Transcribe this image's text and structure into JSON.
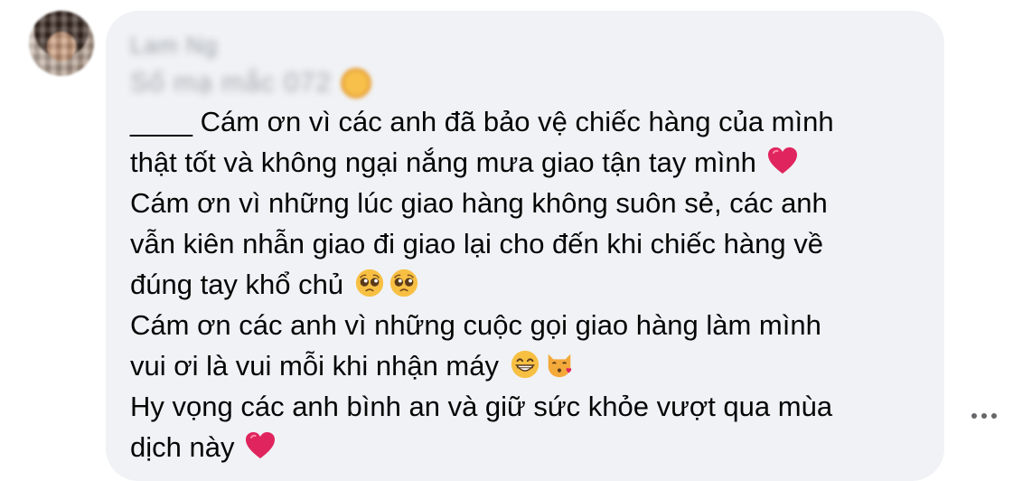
{
  "comment": {
    "author_name": "Lam Ng",
    "author_subline": "Số mạ mắc 072",
    "paragraphs": [
      {
        "line1": "____ Cám ơn vì các anh đã bảo vệ chiếc hàng của mình",
        "line2": "thật tốt và không ngại nắng mưa giao tận tay mình"
      },
      {
        "line1": "Cám ơn vì những lúc giao hàng không suôn sẻ, các anh",
        "line2": "vẫn kiên nhẫn giao đi giao lại cho đến khi chiếc hàng về",
        "line3": "đúng tay khổ chủ"
      },
      {
        "line1": "Cám ơn các anh vì những cuộc gọi giao hàng làm mình",
        "line2": "vui ơi là vui mỗi khi nhận máy"
      },
      {
        "line1": "Hy vọng các anh bình an và giữ sức khỏe vượt qua mùa",
        "line2": "dịch này"
      }
    ],
    "emojis": {
      "heart": "red-heart-icon",
      "pleading": "pleading-face-icon",
      "grin": "grinning-face-icon",
      "kissing_cat": "kissing-cat-icon"
    }
  },
  "actions": {
    "more_icon": "more-options-icon"
  },
  "colors": {
    "bubble_bg": "#f0f2f5",
    "text": "#050505",
    "heart": "#e0245e",
    "more_dots": "#65676b"
  }
}
